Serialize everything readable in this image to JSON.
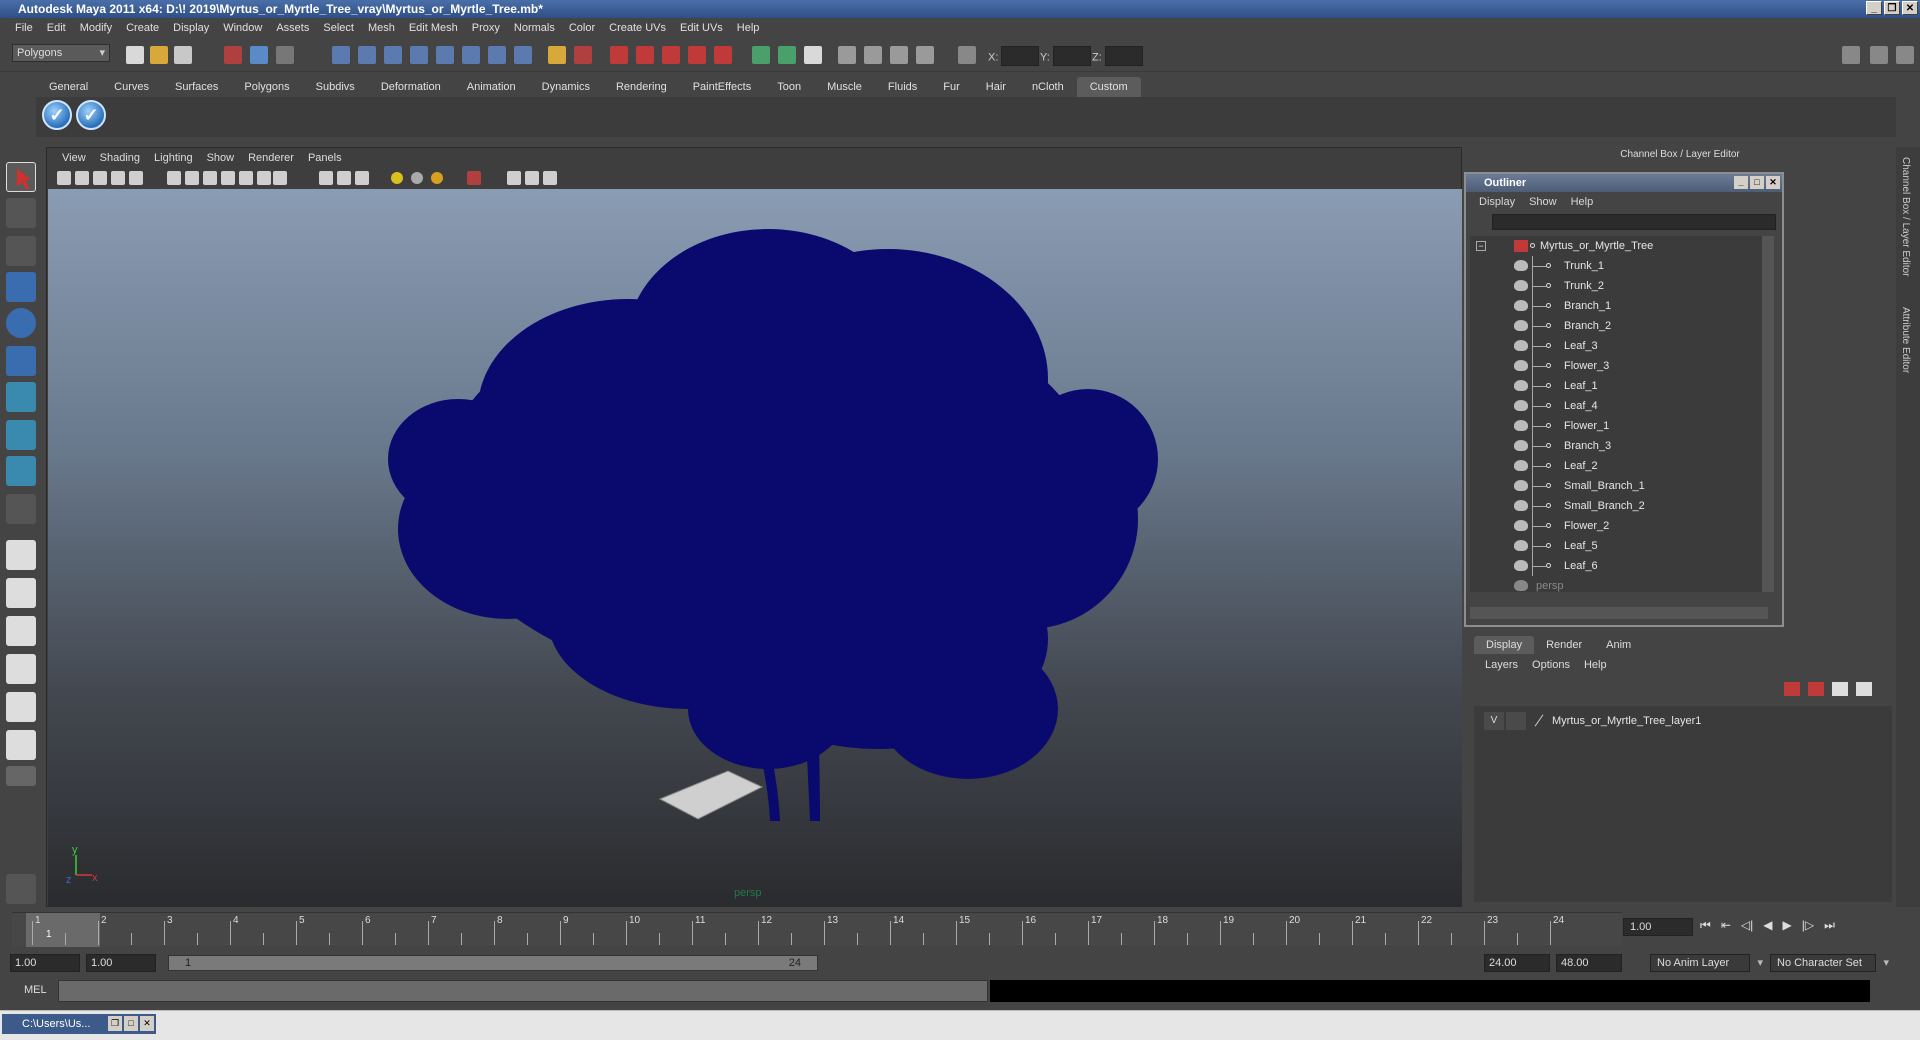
{
  "window": {
    "title": "Autodesk Maya 2011 x64: D:\\! 2019\\Myrtus_or_Myrtle_Tree_vray\\Myrtus_or_Myrtle_Tree.mb*"
  },
  "menubar": [
    "File",
    "Edit",
    "Modify",
    "Create",
    "Display",
    "Window",
    "Assets",
    "Select",
    "Mesh",
    "Edit Mesh",
    "Proxy",
    "Normals",
    "Color",
    "Create UVs",
    "Edit UVs",
    "Help"
  ],
  "statusline": {
    "mode": "Polygons",
    "x_label": "X:",
    "y_label": "Y:",
    "z_label": "Z:"
  },
  "shelf": {
    "tabs": [
      "General",
      "Curves",
      "Surfaces",
      "Polygons",
      "Subdivs",
      "Deformation",
      "Animation",
      "Dynamics",
      "Rendering",
      "PaintEffects",
      "Toon",
      "Muscle",
      "Fluids",
      "Fur",
      "Hair",
      "nCloth",
      "Custom"
    ],
    "active_tab": "Custom"
  },
  "viewport": {
    "menu": [
      "View",
      "Shading",
      "Lighting",
      "Show",
      "Renderer",
      "Panels"
    ],
    "camera_label": "persp",
    "axis_y": "y",
    "axis_x": "x",
    "axis_z": "z"
  },
  "channel_box": {
    "header": "Channel Box / Layer Editor",
    "side_tabs": [
      "Channel Box / Layer Editor",
      "Attribute Editor"
    ]
  },
  "outliner": {
    "title": "Outliner",
    "menu": [
      "Display",
      "Show",
      "Help"
    ],
    "root": "Myrtus_or_Myrtle_Tree",
    "children": [
      "Trunk_1",
      "Trunk_2",
      "Branch_1",
      "Branch_2",
      "Leaf_3",
      "Flower_3",
      "Leaf_1",
      "Leaf_4",
      "Flower_1",
      "Branch_3",
      "Leaf_2",
      "Small_Branch_1",
      "Small_Branch_2",
      "Flower_2",
      "Leaf_5",
      "Leaf_6"
    ],
    "camera": "persp"
  },
  "layer_editor": {
    "tabs": [
      "Display",
      "Render",
      "Anim"
    ],
    "active_tab": "Display",
    "menu": [
      "Layers",
      "Options",
      "Help"
    ],
    "layer_visible": "V",
    "layer_name": "Myrtus_or_Myrtle_Tree_layer1"
  },
  "timeline": {
    "ticks": [
      "1",
      "2",
      "3",
      "4",
      "5",
      "6",
      "7",
      "8",
      "9",
      "10",
      "11",
      "12",
      "13",
      "14",
      "15",
      "16",
      "17",
      "18",
      "19",
      "20",
      "21",
      "22",
      "23",
      "24"
    ],
    "current_frame_marker": "1",
    "current_frame": "1.00"
  },
  "range": {
    "start": "1.00",
    "playback_start": "1.00",
    "slider_start": "1",
    "slider_end": "24",
    "playback_end": "24.00",
    "end": "48.00",
    "anim_layer": "No Anim Layer",
    "character_set": "No Character Set"
  },
  "mel": {
    "label": "MEL"
  },
  "taskbar": {
    "item": "C:\\Users\\Us..."
  },
  "colors": {
    "tree": "#0a0a6e",
    "bg": "#444444",
    "accent": "#4a6fa8"
  }
}
